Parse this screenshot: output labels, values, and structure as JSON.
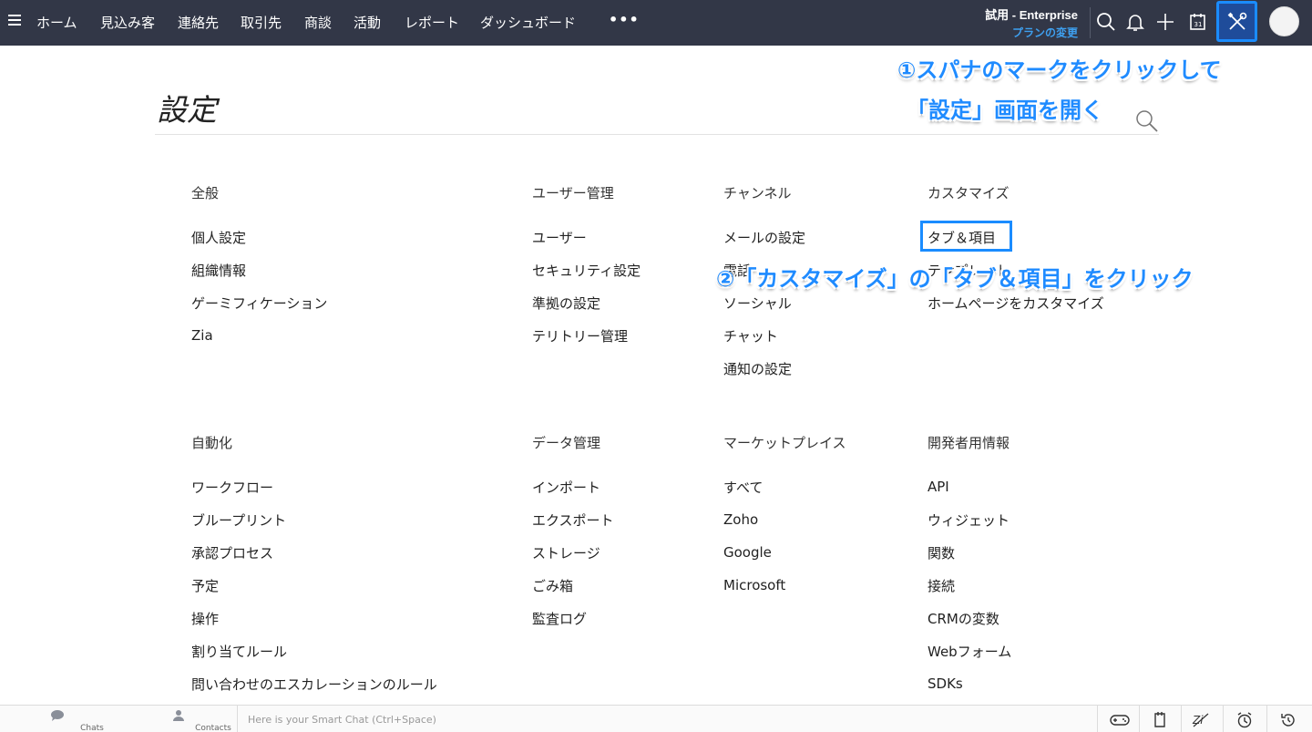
{
  "nav": {
    "items": [
      "ホーム",
      "見込み客",
      "連絡先",
      "取引先",
      "商談",
      "活動",
      "レポート",
      "ダッシュボード"
    ],
    "more": "•••",
    "trial": "試用 - Enterprise",
    "plan_link": "プランの変更"
  },
  "page": {
    "title": "設定"
  },
  "annotations": {
    "step1_line1": "①スパナのマークをクリックして",
    "step1_line2": "「設定」画面を開く",
    "step2": "②「カスタマイズ」の「タブ＆項目」をクリック"
  },
  "sections": {
    "general": {
      "heading": "全般",
      "links": [
        "個人設定",
        "組織情報",
        "ゲーミフィケーション",
        "Zia"
      ]
    },
    "users": {
      "heading": "ユーザー管理",
      "links": [
        "ユーザー",
        "セキュリティ設定",
        "準拠の設定",
        "テリトリー管理"
      ]
    },
    "channels": {
      "heading": "チャンネル",
      "links": [
        "メールの設定",
        "電話",
        "ソーシャル",
        "チャット",
        "通知の設定"
      ]
    },
    "customize": {
      "heading": "カスタマイズ",
      "links": [
        "タブ＆項目",
        "テンプレート",
        "ホームページをカスタマイズ"
      ]
    },
    "automation": {
      "heading": "自動化",
      "links": [
        "ワークフロー",
        "ブループリント",
        "承認プロセス",
        "予定",
        "操作",
        "割り当てルール",
        "問い合わせのエスカレーションのルール"
      ]
    },
    "data": {
      "heading": "データ管理",
      "links": [
        "インポート",
        "エクスポート",
        "ストレージ",
        "ごみ箱",
        "監査ログ"
      ]
    },
    "marketplace": {
      "heading": "マーケットプレイス",
      "links": [
        "すべて",
        "Zoho",
        "Google",
        "Microsoft"
      ]
    },
    "developer": {
      "heading": "開発者用情報",
      "links": [
        "API",
        "ウィジェット",
        "関数",
        "接続",
        "CRMの変数",
        "Webフォーム",
        "SDKs"
      ]
    }
  },
  "bottombar": {
    "chats": "Chats",
    "contacts": "Contacts",
    "chat_placeholder": "Here is your Smart Chat (Ctrl+Space)"
  },
  "colors": {
    "topbar": "#323747",
    "accent": "#1a8cff"
  }
}
